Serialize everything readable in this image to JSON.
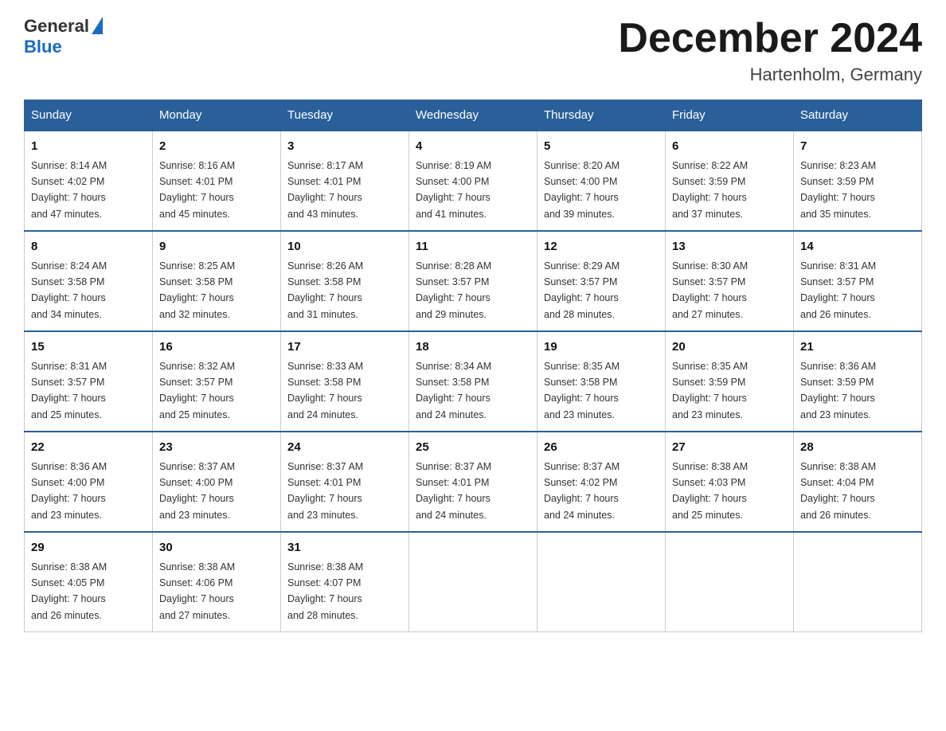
{
  "header": {
    "logo_general": "General",
    "logo_blue": "Blue",
    "month_title": "December 2024",
    "location": "Hartenholm, Germany"
  },
  "days_of_week": [
    "Sunday",
    "Monday",
    "Tuesday",
    "Wednesday",
    "Thursday",
    "Friday",
    "Saturday"
  ],
  "weeks": [
    [
      {
        "day": "1",
        "sunrise": "8:14 AM",
        "sunset": "4:02 PM",
        "daylight": "7 hours and 47 minutes."
      },
      {
        "day": "2",
        "sunrise": "8:16 AM",
        "sunset": "4:01 PM",
        "daylight": "7 hours and 45 minutes."
      },
      {
        "day": "3",
        "sunrise": "8:17 AM",
        "sunset": "4:01 PM",
        "daylight": "7 hours and 43 minutes."
      },
      {
        "day": "4",
        "sunrise": "8:19 AM",
        "sunset": "4:00 PM",
        "daylight": "7 hours and 41 minutes."
      },
      {
        "day": "5",
        "sunrise": "8:20 AM",
        "sunset": "4:00 PM",
        "daylight": "7 hours and 39 minutes."
      },
      {
        "day": "6",
        "sunrise": "8:22 AM",
        "sunset": "3:59 PM",
        "daylight": "7 hours and 37 minutes."
      },
      {
        "day": "7",
        "sunrise": "8:23 AM",
        "sunset": "3:59 PM",
        "daylight": "7 hours and 35 minutes."
      }
    ],
    [
      {
        "day": "8",
        "sunrise": "8:24 AM",
        "sunset": "3:58 PM",
        "daylight": "7 hours and 34 minutes."
      },
      {
        "day": "9",
        "sunrise": "8:25 AM",
        "sunset": "3:58 PM",
        "daylight": "7 hours and 32 minutes."
      },
      {
        "day": "10",
        "sunrise": "8:26 AM",
        "sunset": "3:58 PM",
        "daylight": "7 hours and 31 minutes."
      },
      {
        "day": "11",
        "sunrise": "8:28 AM",
        "sunset": "3:57 PM",
        "daylight": "7 hours and 29 minutes."
      },
      {
        "day": "12",
        "sunrise": "8:29 AM",
        "sunset": "3:57 PM",
        "daylight": "7 hours and 28 minutes."
      },
      {
        "day": "13",
        "sunrise": "8:30 AM",
        "sunset": "3:57 PM",
        "daylight": "7 hours and 27 minutes."
      },
      {
        "day": "14",
        "sunrise": "8:31 AM",
        "sunset": "3:57 PM",
        "daylight": "7 hours and 26 minutes."
      }
    ],
    [
      {
        "day": "15",
        "sunrise": "8:31 AM",
        "sunset": "3:57 PM",
        "daylight": "7 hours and 25 minutes."
      },
      {
        "day": "16",
        "sunrise": "8:32 AM",
        "sunset": "3:57 PM",
        "daylight": "7 hours and 25 minutes."
      },
      {
        "day": "17",
        "sunrise": "8:33 AM",
        "sunset": "3:58 PM",
        "daylight": "7 hours and 24 minutes."
      },
      {
        "day": "18",
        "sunrise": "8:34 AM",
        "sunset": "3:58 PM",
        "daylight": "7 hours and 24 minutes."
      },
      {
        "day": "19",
        "sunrise": "8:35 AM",
        "sunset": "3:58 PM",
        "daylight": "7 hours and 23 minutes."
      },
      {
        "day": "20",
        "sunrise": "8:35 AM",
        "sunset": "3:59 PM",
        "daylight": "7 hours and 23 minutes."
      },
      {
        "day": "21",
        "sunrise": "8:36 AM",
        "sunset": "3:59 PM",
        "daylight": "7 hours and 23 minutes."
      }
    ],
    [
      {
        "day": "22",
        "sunrise": "8:36 AM",
        "sunset": "4:00 PM",
        "daylight": "7 hours and 23 minutes."
      },
      {
        "day": "23",
        "sunrise": "8:37 AM",
        "sunset": "4:00 PM",
        "daylight": "7 hours and 23 minutes."
      },
      {
        "day": "24",
        "sunrise": "8:37 AM",
        "sunset": "4:01 PM",
        "daylight": "7 hours and 23 minutes."
      },
      {
        "day": "25",
        "sunrise": "8:37 AM",
        "sunset": "4:01 PM",
        "daylight": "7 hours and 24 minutes."
      },
      {
        "day": "26",
        "sunrise": "8:37 AM",
        "sunset": "4:02 PM",
        "daylight": "7 hours and 24 minutes."
      },
      {
        "day": "27",
        "sunrise": "8:38 AM",
        "sunset": "4:03 PM",
        "daylight": "7 hours and 25 minutes."
      },
      {
        "day": "28",
        "sunrise": "8:38 AM",
        "sunset": "4:04 PM",
        "daylight": "7 hours and 26 minutes."
      }
    ],
    [
      {
        "day": "29",
        "sunrise": "8:38 AM",
        "sunset": "4:05 PM",
        "daylight": "7 hours and 26 minutes."
      },
      {
        "day": "30",
        "sunrise": "8:38 AM",
        "sunset": "4:06 PM",
        "daylight": "7 hours and 27 minutes."
      },
      {
        "day": "31",
        "sunrise": "8:38 AM",
        "sunset": "4:07 PM",
        "daylight": "7 hours and 28 minutes."
      },
      null,
      null,
      null,
      null
    ]
  ],
  "labels": {
    "sunrise": "Sunrise:",
    "sunset": "Sunset:",
    "daylight": "Daylight:"
  }
}
